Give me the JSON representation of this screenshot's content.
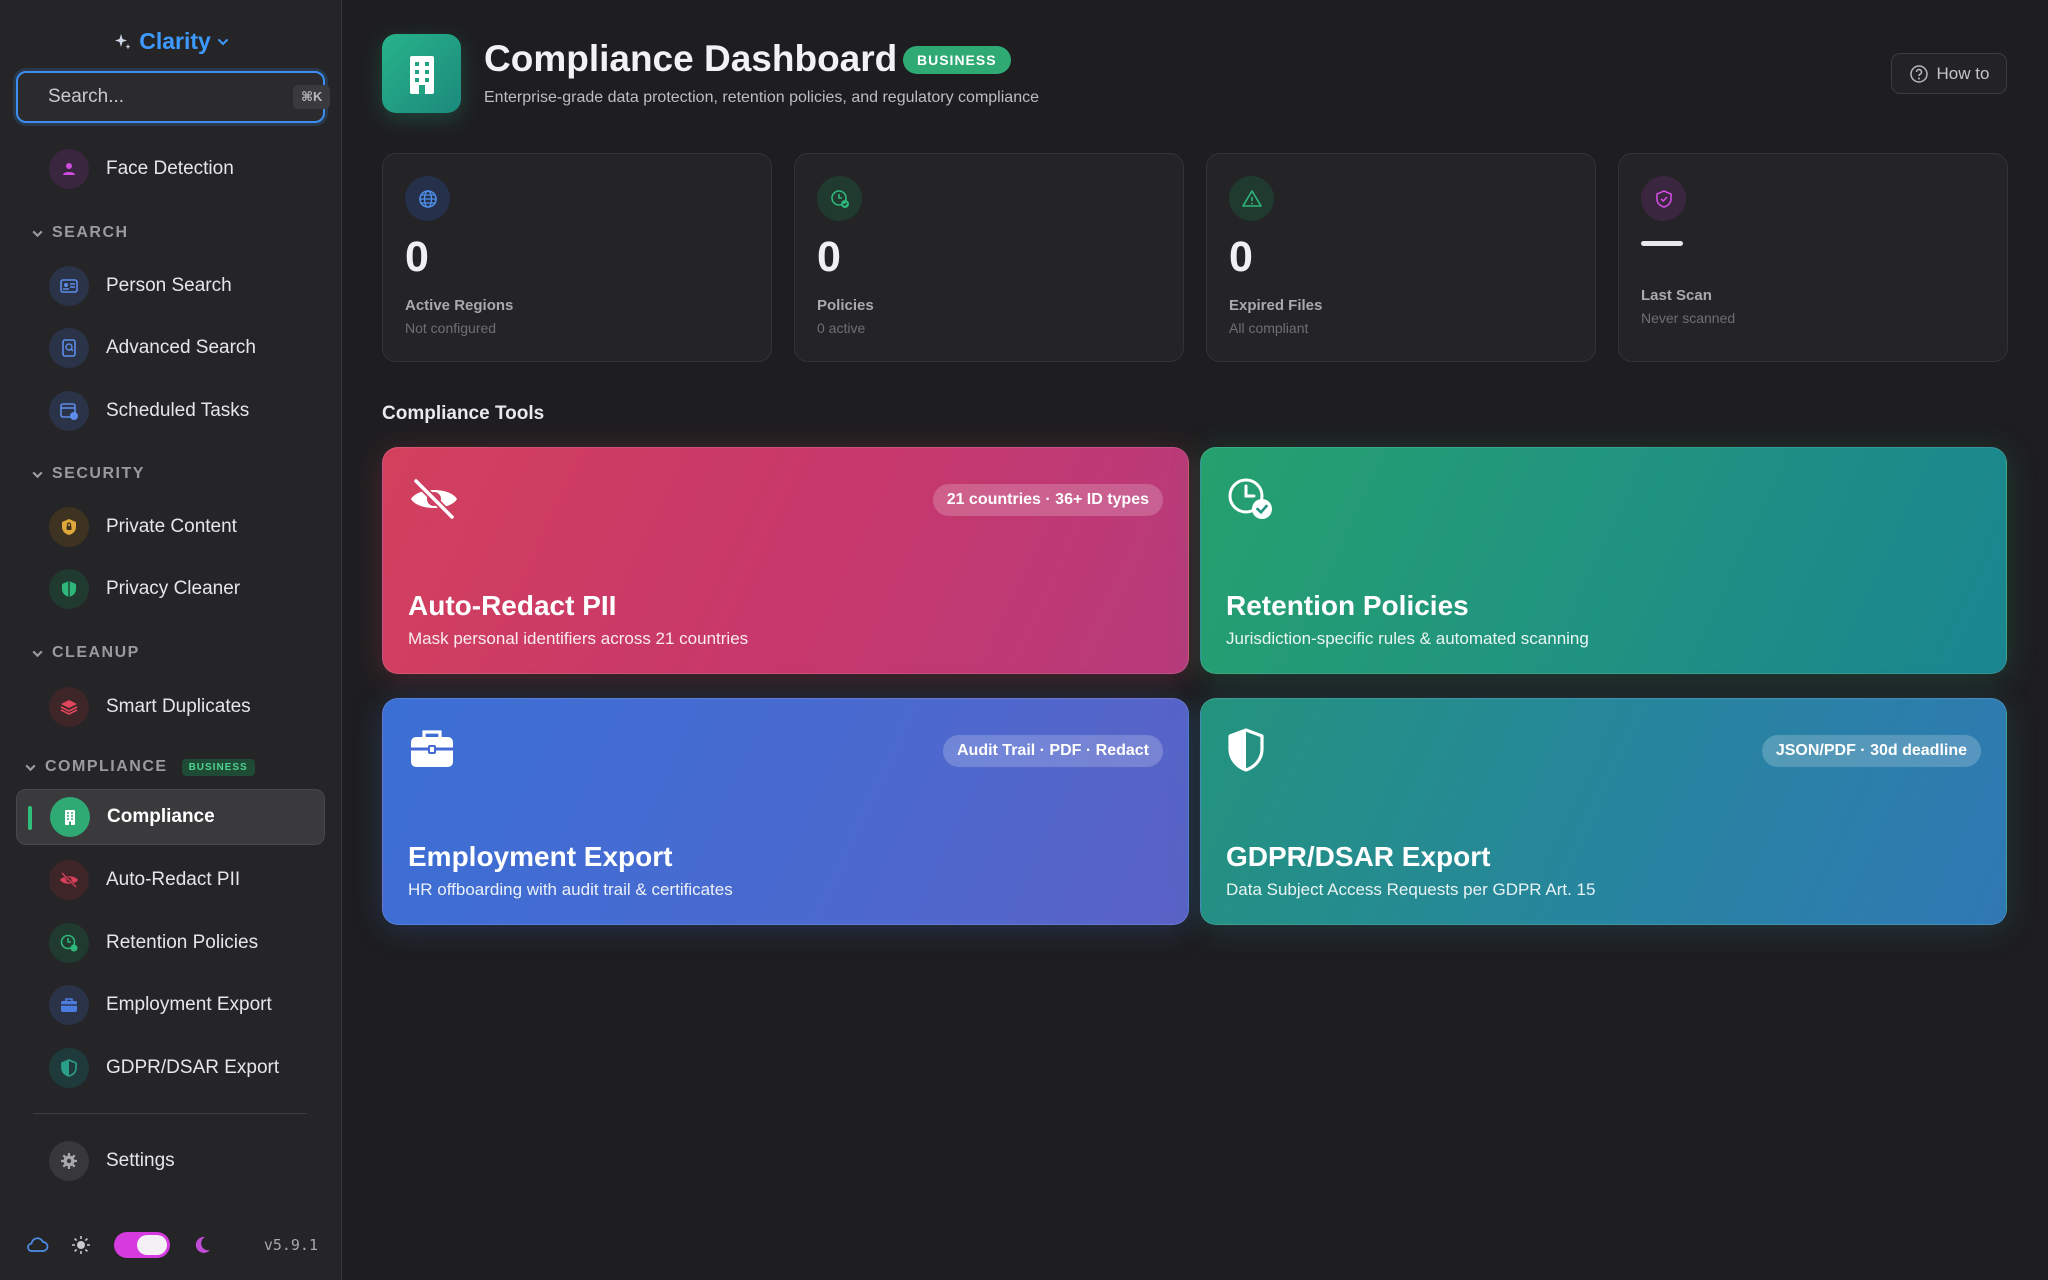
{
  "app": {
    "brand": "Clarity",
    "version": "v5.9.1"
  },
  "search": {
    "placeholder": "Search...",
    "shortcut": "⌘K"
  },
  "sidebar": {
    "top_item": "Face Detection",
    "sections": {
      "search": "SEARCH",
      "security": "SECURITY",
      "cleanup": "CLEANUP",
      "compliance": "COMPLIANCE",
      "compliance_badge": "BUSINESS"
    },
    "items": {
      "person_search": "Person Search",
      "advanced_search": "Advanced Search",
      "scheduled_tasks": "Scheduled Tasks",
      "private_content": "Private Content",
      "privacy_cleaner": "Privacy Cleaner",
      "smart_duplicates": "Smart Duplicates",
      "compliance": "Compliance",
      "auto_redact": "Auto-Redact PII",
      "retention": "Retention Policies",
      "employment": "Employment Export",
      "gdpr": "GDPR/DSAR Export",
      "settings": "Settings"
    },
    "active": "compliance"
  },
  "header": {
    "title": "Compliance Dashboard",
    "badge": "BUSINESS",
    "subtitle": "Enterprise-grade data protection, retention policies, and regulatory compliance",
    "help_button": "How to"
  },
  "stats": [
    {
      "value": "0",
      "label": "Active Regions",
      "sub": "Not configured",
      "icon": "globe-icon"
    },
    {
      "value": "0",
      "label": "Policies",
      "sub": "0 active",
      "icon": "clock-check-icon"
    },
    {
      "value": "0",
      "label": "Expired Files",
      "sub": "All compliant",
      "icon": "warning-icon"
    },
    {
      "value": "",
      "label": "Last Scan",
      "sub": "Never scanned",
      "icon": "shield-check-icon"
    }
  ],
  "tools_section_title": "Compliance Tools",
  "tools": {
    "redact": {
      "title": "Auto-Redact PII",
      "desc": "Mask personal identifiers across 21 countries",
      "tag": "21 countries · 36+ ID types"
    },
    "retention": {
      "title": "Retention Policies",
      "desc": "Jurisdiction-specific rules & automated scanning",
      "tag": ""
    },
    "employment": {
      "title": "Employment Export",
      "desc": "HR offboarding with audit trail & certificates",
      "tag": "Audit Trail · PDF · Redact"
    },
    "gdpr": {
      "title": "GDPR/DSAR Export",
      "desc": "Data Subject Access Requests per GDPR Art. 15",
      "tag": "JSON/PDF · 30d deadline"
    }
  },
  "colors": {
    "accent": "#3d9bff",
    "business_green": "#2faa75",
    "redact": "#d2405d",
    "retention": "#26a06e",
    "employment": "#3b6fd4",
    "gdpr": "#2785a0",
    "theme_toggle": "#d63be0"
  },
  "theme_toggle": {
    "mode": "dark"
  }
}
